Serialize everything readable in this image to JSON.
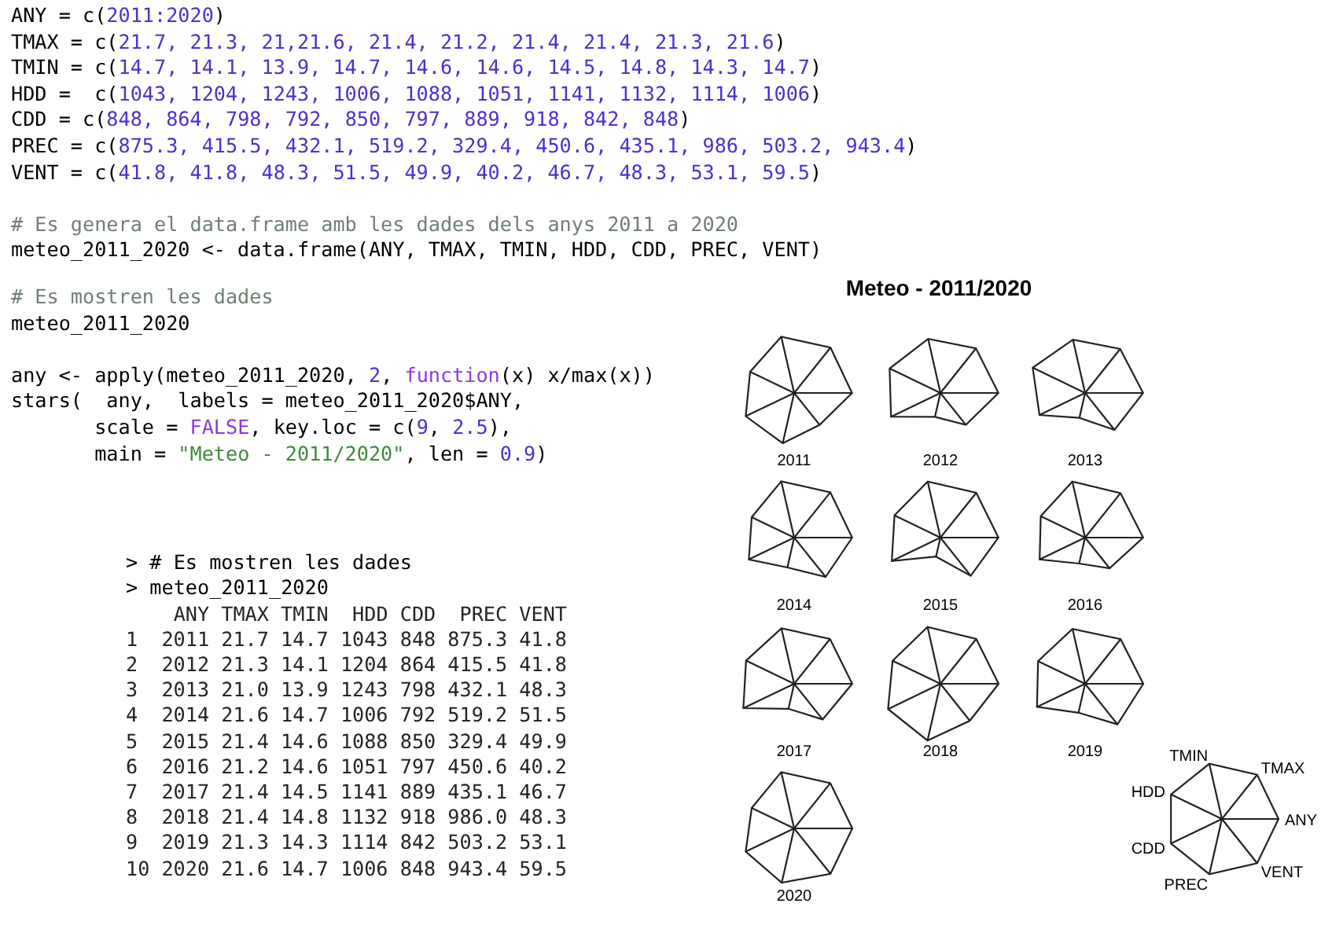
{
  "code_top": [
    {
      "lines": [
        [
          {
            "text": "ANY = c(",
            "kind": "plain"
          },
          {
            "text": "2011:2020",
            "kind": "number"
          },
          {
            "text": ")",
            "kind": "plain"
          }
        ],
        [
          {
            "text": "TMAX = c(",
            "kind": "plain"
          },
          {
            "text": "21.7, 21.3, 21,21.6, 21.4, 21.2, 21.4, 21.4, 21.3, 21.6",
            "kind": "number"
          },
          {
            "text": ")",
            "kind": "plain"
          }
        ],
        [
          {
            "text": "TMIN = c(",
            "kind": "plain"
          },
          {
            "text": "14.7, 14.1, 13.9, 14.7, 14.6, 14.6, 14.5, 14.8, 14.3, 14.7",
            "kind": "number"
          },
          {
            "text": ")",
            "kind": "plain"
          }
        ],
        [
          {
            "text": "HDD =  c(",
            "kind": "plain"
          },
          {
            "text": "1043, 1204, 1243, 1006, 1088, 1051, 1141, 1132, 1114, 1006",
            "kind": "number"
          },
          {
            "text": ")",
            "kind": "plain"
          }
        ],
        [
          {
            "text": "CDD = c(",
            "kind": "plain"
          },
          {
            "text": "848, 864, 798, 792, 850, 797, 889, 918, 842, 848",
            "kind": "number"
          },
          {
            "text": ")",
            "kind": "plain"
          }
        ],
        [
          {
            "text": "PREC = c(",
            "kind": "plain"
          },
          {
            "text": "875.3, 415.5, 432.1, 519.2, 329.4, 450.6, 435.1, 986, 503.2, 943.4",
            "kind": "number"
          },
          {
            "text": ")",
            "kind": "plain"
          }
        ],
        [
          {
            "text": "VENT = c(",
            "kind": "plain"
          },
          {
            "text": "41.8, 41.8, 48.3, 51.5, 49.9, 40.2, 46.7, 48.3, 53.1, 59.5",
            "kind": "number"
          },
          {
            "text": ")",
            "kind": "plain"
          }
        ]
      ]
    },
    {
      "lines": [
        [
          {
            "text": "# Es genera el data.frame amb les dades dels anys 2011 a 2020",
            "kind": "comment"
          }
        ],
        [
          {
            "text": "meteo_2011_2020 <- data.frame(ANY, TMAX, TMIN, HDD, CDD, PREC, VENT)",
            "kind": "plain"
          }
        ]
      ]
    }
  ],
  "code_left": [
    {
      "lines": [
        [
          {
            "text": "# Es mostren les dades",
            "kind": "comment"
          }
        ],
        [
          {
            "text": "meteo_2011_2020",
            "kind": "plain"
          }
        ]
      ]
    },
    {
      "lines": [
        [
          {
            "text": "any <- apply(meteo_2011_2020, ",
            "kind": "plain"
          },
          {
            "text": "2",
            "kind": "number"
          },
          {
            "text": ", ",
            "kind": "plain"
          },
          {
            "text": "function",
            "kind": "keyword"
          },
          {
            "text": "(x) x/max(x))",
            "kind": "plain"
          }
        ],
        [
          {
            "text": "stars(  any,  labels = meteo_2011_2020$ANY,",
            "kind": "plain"
          }
        ],
        [
          {
            "text": "       scale = ",
            "kind": "plain"
          },
          {
            "text": "FALSE",
            "kind": "keyword"
          },
          {
            "text": ", key.loc = c(",
            "kind": "plain"
          },
          {
            "text": "9",
            "kind": "number"
          },
          {
            "text": ", ",
            "kind": "plain"
          },
          {
            "text": "2.5",
            "kind": "number"
          },
          {
            "text": "),",
            "kind": "plain"
          }
        ],
        [
          {
            "text": "       main = ",
            "kind": "plain"
          },
          {
            "text": "\"Meteo - 2011/2020\"",
            "kind": "string"
          },
          {
            "text": ", len = ",
            "kind": "plain"
          },
          {
            "text": "0.9",
            "kind": "number"
          },
          {
            "text": ")",
            "kind": "plain"
          }
        ]
      ]
    }
  ],
  "console": {
    "lines": [
      "> # Es mostren les dades",
      "> meteo_2011_2020"
    ],
    "table": {
      "columns": [
        "ANY",
        "TMAX",
        "TMIN",
        "HDD",
        "CDD",
        "PREC",
        "VENT"
      ],
      "rows": [
        {
          "row": "1",
          "cells": [
            "2011",
            "21.7",
            "14.7",
            "1043",
            "848",
            "875.3",
            "41.8"
          ]
        },
        {
          "row": "2",
          "cells": [
            "2012",
            "21.3",
            "14.1",
            "1204",
            "864",
            "415.5",
            "41.8"
          ]
        },
        {
          "row": "3",
          "cells": [
            "2013",
            "21.0",
            "13.9",
            "1243",
            "798",
            "432.1",
            "48.3"
          ]
        },
        {
          "row": "4",
          "cells": [
            "2014",
            "21.6",
            "14.7",
            "1006",
            "792",
            "519.2",
            "51.5"
          ]
        },
        {
          "row": "5",
          "cells": [
            "2015",
            "21.4",
            "14.6",
            "1088",
            "850",
            "329.4",
            "49.9"
          ]
        },
        {
          "row": "6",
          "cells": [
            "2016",
            "21.2",
            "14.6",
            "1051",
            "797",
            "450.6",
            "40.2"
          ]
        },
        {
          "row": "7",
          "cells": [
            "2017",
            "21.4",
            "14.5",
            "1141",
            "889",
            "435.1",
            "46.7"
          ]
        },
        {
          "row": "8",
          "cells": [
            "2018",
            "21.4",
            "14.8",
            "1132",
            "918",
            "986.0",
            "48.3"
          ]
        },
        {
          "row": "9",
          "cells": [
            "2019",
            "21.3",
            "14.3",
            "1114",
            "842",
            "503.2",
            "53.1"
          ]
        },
        {
          "row": "10",
          "cells": [
            "2020",
            "21.6",
            "14.7",
            "1006",
            "848",
            "943.4",
            "59.5"
          ]
        }
      ]
    }
  },
  "star_plot": {
    "title": "Meteo - 2011/2020",
    "labels": [
      "2011",
      "2012",
      "2013",
      "2014",
      "2015",
      "2016",
      "2017",
      "2018",
      "2019",
      "2020"
    ],
    "key_labels": [
      "ANY",
      "TMAX",
      "TMIN",
      "HDD",
      "CDD",
      "PREC",
      "VENT"
    ]
  }
}
